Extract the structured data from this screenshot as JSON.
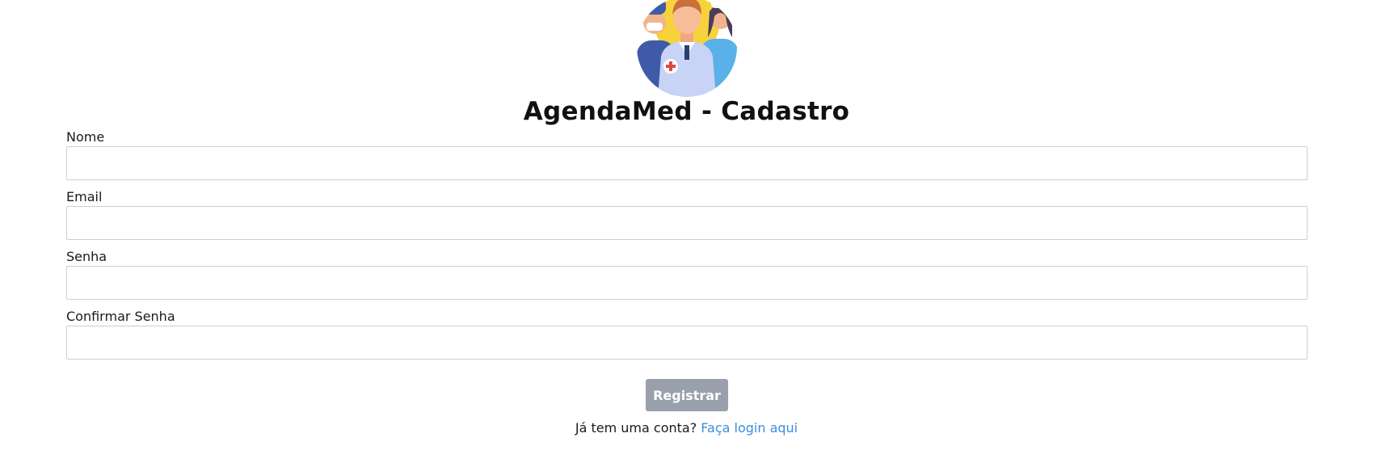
{
  "header": {
    "logo_icon": "medical-team-avatar-icon",
    "title": "AgendaMed - Cadastro"
  },
  "form": {
    "fields": [
      {
        "label": "Nome",
        "value": "",
        "placeholder": ""
      },
      {
        "label": "Email",
        "value": "",
        "placeholder": ""
      },
      {
        "label": "Senha",
        "value": "",
        "placeholder": ""
      },
      {
        "label": "Confirmar Senha",
        "value": "",
        "placeholder": ""
      }
    ],
    "submit_label": "Registrar"
  },
  "footer": {
    "prompt": "Já tem uma conta?",
    "link_label": "Faça login aqui"
  },
  "colors": {
    "button_bg": "#9aa0ab",
    "link": "#3b8de0",
    "input_border": "#cfcfcf"
  }
}
